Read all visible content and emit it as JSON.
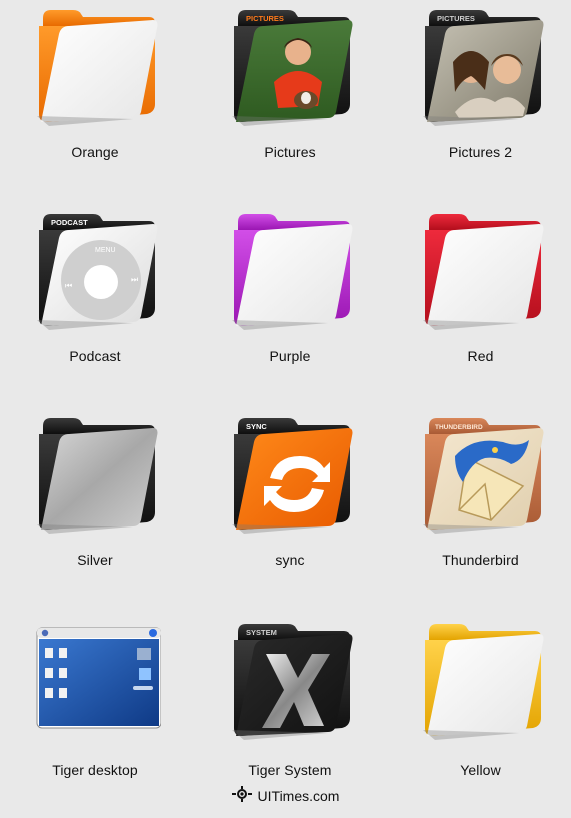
{
  "icons": [
    {
      "label": "Orange",
      "tab_text": "",
      "color": "#f57a00",
      "type": "plain"
    },
    {
      "label": "Pictures",
      "tab_text": "PICTURES",
      "color": "#ff7a1a",
      "type": "photo"
    },
    {
      "label": "Pictures 2",
      "tab_text": "PICTURES",
      "color": "#bbbbbb",
      "type": "photo2"
    },
    {
      "label": "Podcast",
      "tab_text": "PODCAST",
      "color": "#ffffff",
      "type": "podcast",
      "menu_text": "MENU"
    },
    {
      "label": "Purple",
      "tab_text": "",
      "color": "#b022c8",
      "type": "plain"
    },
    {
      "label": "Red",
      "tab_text": "",
      "color": "#d41124",
      "type": "plain"
    },
    {
      "label": "Silver",
      "tab_text": "",
      "color": "#222222",
      "type": "silver"
    },
    {
      "label": "sync",
      "tab_text": "SYNC",
      "color": "#f36a00",
      "type": "sync"
    },
    {
      "label": "Thunderbird",
      "tab_text": "THUNDERBIRD",
      "color": "#c77448",
      "type": "thunderbird"
    },
    {
      "label": "Tiger desktop",
      "tab_text": "",
      "color": "#2456a8",
      "type": "desktop"
    },
    {
      "label": "Tiger System",
      "tab_text": "SYSTEM",
      "color": "#222222",
      "type": "system"
    },
    {
      "label": "Yellow",
      "tab_text": "",
      "color": "#f2b800",
      "type": "plain"
    }
  ],
  "watermark": {
    "text": "UITimes.com"
  }
}
